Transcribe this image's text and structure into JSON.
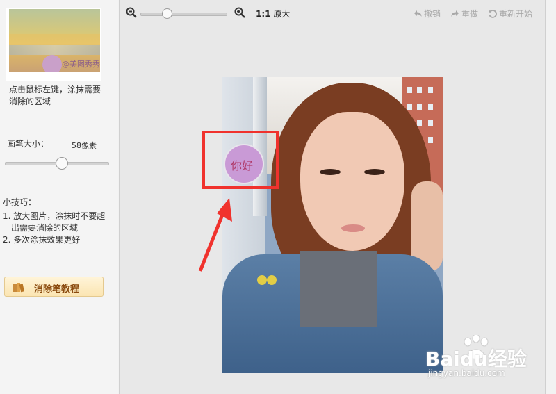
{
  "sidebar": {
    "thumbnail_watermark": "@美图秀秀",
    "instruction": "点击鼠标左键，涂抹需要消除的区域",
    "brush": {
      "label": "画笔大小：",
      "value": "58像素",
      "level_fraction": 0.55
    },
    "tips": {
      "title": "小技巧：",
      "items": [
        "1. 放大图片，涂抹时不要超出需要消除的区域",
        "2. 多次涂抹效果更好"
      ]
    },
    "tutorial_button": "消除笔教程"
  },
  "toolbar": {
    "zoom_fraction": 0.3,
    "ratio_strong": "1:1",
    "ratio_label": "原大",
    "undo": "撤销",
    "redo": "重做",
    "restart": "重新开始"
  },
  "canvas": {
    "overlay_text": "你好"
  },
  "watermark": {
    "title": "Baidu经验",
    "subtitle": "jingyan.baidu.com"
  },
  "colors": {
    "highlight": "#f0322d",
    "overlay_circle": "#c99ad6",
    "overlay_text": "#b03a6a",
    "tutorial_text": "#8a4a0e"
  }
}
